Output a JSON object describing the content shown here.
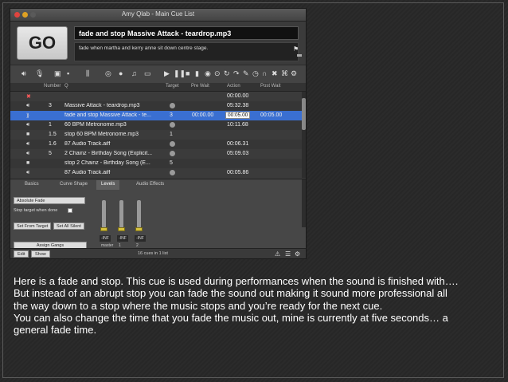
{
  "window": {
    "title": "Amy Qlab - Main Cue List",
    "go_label": "GO",
    "current_cue_title": "fade and stop Massive Attack - teardrop.mp3",
    "current_cue_notes": "fade when martha and kerry anne sit down centre stage."
  },
  "toolbar": {
    "icons": [
      "audio-icon",
      "mic-icon",
      "video-icon",
      "camera-icon",
      "fader-icon",
      "target-icon",
      "circle-icon",
      "music-icon",
      "group-icon",
      "play-icon",
      "pause-icon",
      "stop-icon",
      "load-icon",
      "record-icon",
      "goto-icon",
      "refresh-icon",
      "arc-icon",
      "wrench-icon",
      "clock-icon",
      "x-icon",
      "cmd-icon",
      "gear-icon"
    ]
  },
  "table": {
    "headers": {
      "number": "Number",
      "q": "Q",
      "target": "Target",
      "pre_wait": "Pre Wait",
      "action": "Action",
      "post_wait": "Post Wait"
    },
    "rows": [
      {
        "icon": "x",
        "number": "",
        "name": "",
        "target": "",
        "pre_wait": "",
        "action": "00:00.00",
        "post_wait": "",
        "style": "normal"
      },
      {
        "icon": "audio",
        "number": "3",
        "name": "Massive Attack - teardrop.mp3",
        "target": "",
        "pre_wait": "",
        "action": "05:32.38",
        "post_wait": "",
        "style": "alt"
      },
      {
        "icon": "fade",
        "number": "",
        "name": "fade and stop Massive Attack - te...",
        "target": "3",
        "pre_wait": "00:00.00",
        "action": "00:05.00",
        "post_wait": "00:05.00",
        "style": "sel"
      },
      {
        "icon": "audio",
        "number": "1",
        "name": "60 BPM Metronome.mp3",
        "target": "",
        "pre_wait": "",
        "action": "10:11.68",
        "post_wait": "",
        "style": "alt"
      },
      {
        "icon": "stop",
        "number": "1.5",
        "name": "stop 60 BPM Metronome.mp3",
        "target": "1",
        "pre_wait": "",
        "action": "",
        "post_wait": "",
        "style": "normal"
      },
      {
        "icon": "audio",
        "number": "1.6",
        "name": "87 Audio Track.aiff",
        "target": "",
        "pre_wait": "",
        "action": "00:06.31",
        "post_wait": "",
        "style": "alt"
      },
      {
        "icon": "audio",
        "number": "5",
        "name": "2 Chainz - Birthday Song (Explicit...",
        "target": "",
        "pre_wait": "",
        "action": "05:09.03",
        "post_wait": "",
        "style": "normal"
      },
      {
        "icon": "stop",
        "number": "",
        "name": "stop 2 Chainz - Birthday Song (E...",
        "target": "5",
        "pre_wait": "",
        "action": "",
        "post_wait": "",
        "style": "alt"
      },
      {
        "icon": "audio",
        "number": "",
        "name": "87 Audio Track.aiff",
        "target": "",
        "pre_wait": "",
        "action": "00:05.86",
        "post_wait": "",
        "style": "normal"
      }
    ]
  },
  "inspector": {
    "tabs": [
      "Basics",
      "Curve Shape",
      "Levels",
      "Audio Effects"
    ],
    "active_tab": "Levels",
    "fade_type": "Absolute Fade",
    "stop_target_label": "Stop target when done",
    "set_from_target": "Set From Target",
    "set_all_silent": "Set All Silent",
    "assign_gangs": "Assign Gangs",
    "faders": [
      {
        "name": "master",
        "value": "-INF"
      },
      {
        "name": "1",
        "value": "-INF"
      },
      {
        "name": "2",
        "value": "-INF"
      }
    ]
  },
  "statusbar": {
    "edit": "Edit",
    "show": "Show",
    "count_text": "16 cues in 1 list"
  },
  "caption": {
    "p1": "Here is a fade and stop. This cue is used during performances when the sound is finished with…. But instead of an abrupt stop you can fade the sound out making it sound more professional all the way down to a stop where the music stops and you’re ready for the next cue.",
    "p2": "You can also change the time that you fade the music out, mine is currently at five seconds… a general fade time."
  }
}
